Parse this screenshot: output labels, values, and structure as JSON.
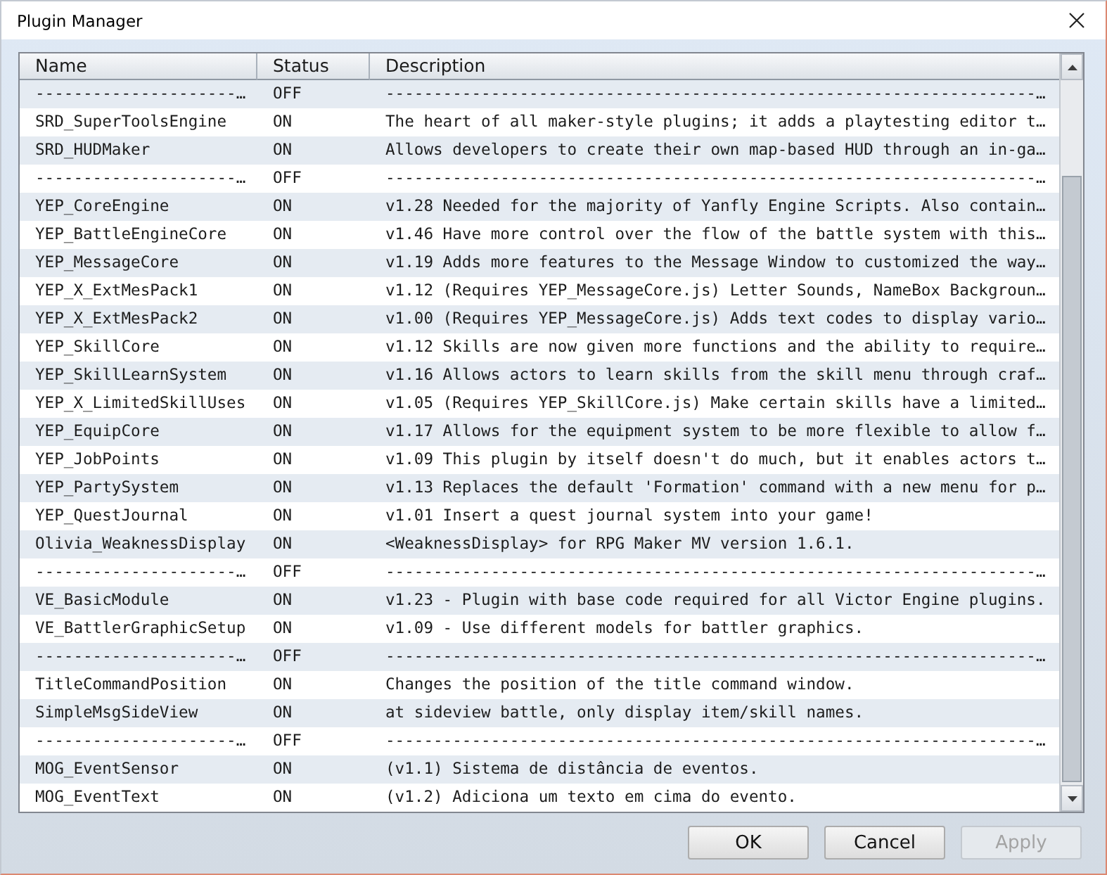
{
  "window": {
    "title": "Plugin Manager"
  },
  "table": {
    "columns": [
      "Name",
      "Status",
      "Description"
    ],
    "rows": [
      {
        "name": "---------------------…",
        "status": "OFF",
        "description": "--------------------------------------------------------------------…"
      },
      {
        "name": "SRD_SuperToolsEngine",
        "status": "ON",
        "description": "The heart of all maker-style plugins; it adds a playtesting editor t…"
      },
      {
        "name": "SRD_HUDMaker",
        "status": "ON",
        "description": "Allows developers to create their own map-based HUD through an in-ga…"
      },
      {
        "name": "---------------------…",
        "status": "OFF",
        "description": "--------------------------------------------------------------------…"
      },
      {
        "name": "YEP_CoreEngine",
        "status": "ON",
        "description": "v1.28 Needed for the majority of Yanfly Engine Scripts. Also contain…"
      },
      {
        "name": "YEP_BattleEngineCore",
        "status": "ON",
        "description": "v1.46 Have more control over the flow of the battle system with this…"
      },
      {
        "name": "YEP_MessageCore",
        "status": "ON",
        "description": "v1.19 Adds more features to the Message Window to customized the way…"
      },
      {
        "name": "YEP_X_ExtMesPack1",
        "status": "ON",
        "description": "v1.12 (Requires YEP_MessageCore.js) Letter Sounds, NameBox Backgroun…"
      },
      {
        "name": "YEP_X_ExtMesPack2",
        "status": "ON",
        "description": "v1.00 (Requires YEP_MessageCore.js) Adds text codes to display vario…"
      },
      {
        "name": "YEP_SkillCore",
        "status": "ON",
        "description": "v1.12 Skills are now given more functions and the ability to require…"
      },
      {
        "name": "YEP_SkillLearnSystem",
        "status": "ON",
        "description": "v1.16 Allows actors to learn skills from the skill menu through craf…"
      },
      {
        "name": "YEP_X_LimitedSkillUses",
        "status": "ON",
        "description": "v1.05 (Requires YEP_SkillCore.js) Make certain skills have a limited…"
      },
      {
        "name": "YEP_EquipCore",
        "status": "ON",
        "description": "v1.17 Allows for the equipment system to be more flexible to allow f…"
      },
      {
        "name": "YEP_JobPoints",
        "status": "ON",
        "description": "v1.09 This plugin by itself doesn't do much, but it enables actors t…"
      },
      {
        "name": "YEP_PartySystem",
        "status": "ON",
        "description": "v1.13 Replaces the default 'Formation' command with a new menu for p…"
      },
      {
        "name": "YEP_QuestJournal",
        "status": "ON",
        "description": "v1.01 Insert a quest journal system into your game!"
      },
      {
        "name": "Olivia_WeaknessDisplay",
        "status": "ON",
        "description": "<WeaknessDisplay> for RPG Maker MV version 1.6.1."
      },
      {
        "name": "---------------------…",
        "status": "OFF",
        "description": "--------------------------------------------------------------------…"
      },
      {
        "name": "VE_BasicModule",
        "status": "ON",
        "description": "v1.23 - Plugin with base code required for all Victor Engine plugins."
      },
      {
        "name": "VE_BattlerGraphicSetup",
        "status": "ON",
        "description": "v1.09 - Use different models for battler graphics."
      },
      {
        "name": "---------------------…",
        "status": "OFF",
        "description": "--------------------------------------------------------------------…"
      },
      {
        "name": "TitleCommandPosition",
        "status": "ON",
        "description": "Changes the position of the title command window."
      },
      {
        "name": "SimpleMsgSideView",
        "status": "ON",
        "description": "at sideview battle, only display item/skill names."
      },
      {
        "name": "---------------------…",
        "status": "OFF",
        "description": "--------------------------------------------------------------------…"
      },
      {
        "name": "MOG_EventSensor",
        "status": "ON",
        "description": "(v1.1) Sistema de distância de eventos."
      },
      {
        "name": "MOG_EventText",
        "status": "ON",
        "description": "(v1.2) Adiciona um texto em cima do evento."
      }
    ]
  },
  "buttons": [
    {
      "label": "OK",
      "disabled": false
    },
    {
      "label": "Cancel",
      "disabled": false
    },
    {
      "label": "Apply",
      "disabled": true
    }
  ]
}
